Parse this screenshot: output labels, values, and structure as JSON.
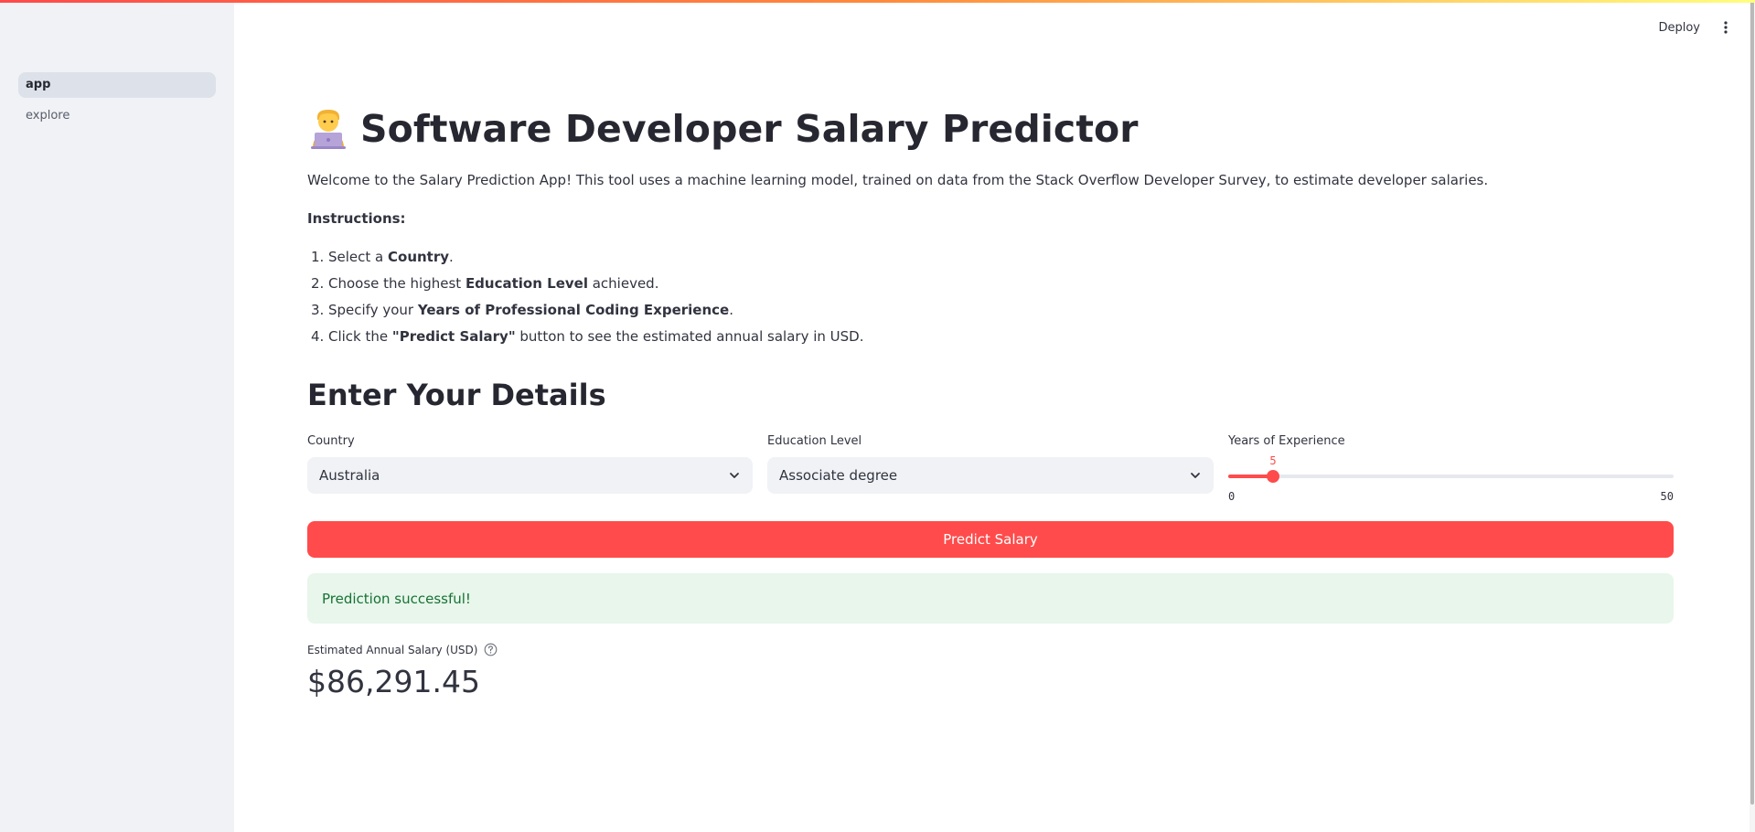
{
  "sidebar": {
    "items": [
      {
        "label": "app",
        "active": true
      },
      {
        "label": "explore",
        "active": false
      }
    ]
  },
  "header": {
    "deploy_label": "Deploy",
    "menu_icon": "kebab-vertical-icon"
  },
  "main": {
    "title_icon": "technologist-emoji",
    "title": "Software Developer Salary Predictor",
    "intro": "Welcome to the Salary Prediction App! This tool uses a machine learning model, trained on data from the Stack Overflow Developer Survey, to estimate developer salaries.",
    "instructions_heading": "Instructions:",
    "steps": [
      {
        "num": "1.",
        "pre": "Select a ",
        "bold": "Country",
        "post": "."
      },
      {
        "num": "2.",
        "pre": "Choose the highest ",
        "bold": "Education Level",
        "post": " achieved."
      },
      {
        "num": "3.",
        "pre": "Specify your ",
        "bold": "Years of Professional Coding Experience",
        "post": "."
      },
      {
        "num": "4.",
        "pre": "Click the ",
        "bold": "\"Predict Salary\"",
        "post": " button to see the estimated annual salary in USD."
      }
    ],
    "details_heading": "Enter Your Details",
    "country": {
      "label": "Country",
      "value": "Australia"
    },
    "education": {
      "label": "Education Level",
      "value": "Associate degree"
    },
    "experience": {
      "label": "Years of Experience",
      "value": "5",
      "min": "0",
      "max": "50",
      "fraction": 0.1
    },
    "predict_label": "Predict Salary",
    "success_message": "Prediction successful!",
    "metric_label": "Estimated Annual Salary (USD)",
    "metric_value": "$86,291.45"
  },
  "colors": {
    "primary": "#ff4b4b",
    "sidebar_bg": "#f0f2f6",
    "success_bg": "#e8f6ec",
    "success_text": "#177233"
  }
}
